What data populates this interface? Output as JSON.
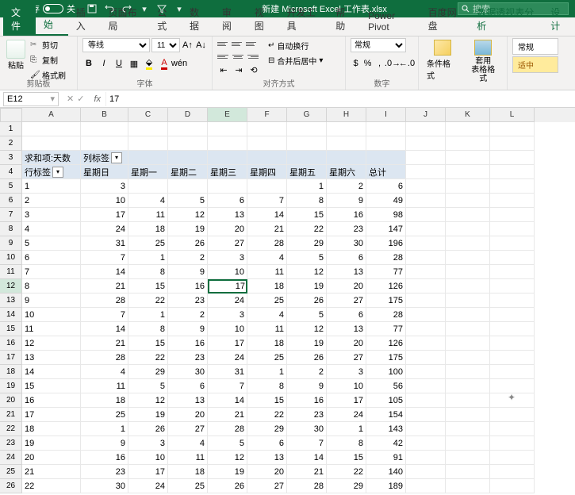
{
  "titlebar": {
    "autosave": "自动保存",
    "autosave_state": "关",
    "filename": "新建 Microsoft Excel 工作表.xlsx",
    "search_placeholder": "搜索"
  },
  "tabs": {
    "file": "文件",
    "home": "开始",
    "insert": "插入",
    "layout": "页面布局",
    "formulas": "公式",
    "data": "数据",
    "review": "审阅",
    "view": "视图",
    "dev": "开发工具",
    "help": "帮助",
    "powerpivot": "Power Pivot",
    "baidupan": "百度网盘",
    "pivot_analyze": "数据透视表分析",
    "design": "设计"
  },
  "ribbon": {
    "clipboard": {
      "group": "剪贴板",
      "paste": "粘贴",
      "cut": "剪切",
      "copy": "复制",
      "painter": "格式刷"
    },
    "font": {
      "group": "字体",
      "name": "等线",
      "size": "11",
      "bold": "B",
      "italic": "I",
      "underline": "U"
    },
    "align": {
      "group": "对齐方式",
      "wrap": "自动换行",
      "merge": "合并后居中"
    },
    "number": {
      "group": "数字",
      "format": "常规"
    },
    "styles": {
      "cond": "条件格式",
      "table": "套用\n表格格式",
      "normal": "常规",
      "mid": "适中"
    }
  },
  "formula_bar": {
    "cell_ref": "E12",
    "fx": "fx",
    "value": "17"
  },
  "grid": {
    "col_widths": {
      "A": 74,
      "B": 60,
      "C": 50,
      "D": 50,
      "E": 50,
      "F": 50,
      "G": 50,
      "H": 50,
      "I": 50,
      "J": 50,
      "K": 56,
      "L": 56
    },
    "col_letters": [
      "A",
      "B",
      "C",
      "D",
      "E",
      "F",
      "G",
      "H",
      "I",
      "J",
      "K",
      "L"
    ],
    "active_row": 12,
    "active_col": "E",
    "pivot": {
      "value_label": "求和项:天数",
      "col_label": "列标签",
      "row_label": "行标签",
      "headers": [
        "星期日",
        "星期一",
        "星期二",
        "星期三",
        "星期四",
        "星期五",
        "星期六",
        "总计"
      ]
    },
    "rows": [
      {
        "r": 1,
        "cells": [
          "",
          "",
          "",
          "",
          "",
          "",
          "",
          "",
          "",
          "",
          "",
          ""
        ]
      },
      {
        "r": 2,
        "cells": [
          "",
          "",
          "",
          "",
          "",
          "",
          "",
          "",
          "",
          "",
          "",
          ""
        ]
      },
      {
        "r": 3,
        "pivot_top": true
      },
      {
        "r": 4,
        "pivot_hdr": true
      },
      {
        "r": 5,
        "cells": [
          "1",
          "3",
          "",
          "",
          "",
          "",
          "1",
          "2",
          "6",
          "",
          "",
          ""
        ]
      },
      {
        "r": 6,
        "cells": [
          "2",
          "10",
          "4",
          "5",
          "6",
          "7",
          "8",
          "9",
          "49",
          "",
          "",
          ""
        ]
      },
      {
        "r": 7,
        "cells": [
          "3",
          "17",
          "11",
          "12",
          "13",
          "14",
          "15",
          "16",
          "98",
          "",
          "",
          ""
        ]
      },
      {
        "r": 8,
        "cells": [
          "4",
          "24",
          "18",
          "19",
          "20",
          "21",
          "22",
          "23",
          "147",
          "",
          "",
          ""
        ]
      },
      {
        "r": 9,
        "cells": [
          "5",
          "31",
          "25",
          "26",
          "27",
          "28",
          "29",
          "30",
          "196",
          "",
          "",
          ""
        ]
      },
      {
        "r": 10,
        "cells": [
          "6",
          "7",
          "1",
          "2",
          "3",
          "4",
          "5",
          "6",
          "28",
          "",
          "",
          ""
        ]
      },
      {
        "r": 11,
        "cells": [
          "7",
          "14",
          "8",
          "9",
          "10",
          "11",
          "12",
          "13",
          "77",
          "",
          "",
          ""
        ]
      },
      {
        "r": 12,
        "cells": [
          "8",
          "21",
          "15",
          "16",
          "17",
          "18",
          "19",
          "20",
          "126",
          "",
          "",
          ""
        ]
      },
      {
        "r": 13,
        "cells": [
          "9",
          "28",
          "22",
          "23",
          "24",
          "25",
          "26",
          "27",
          "175",
          "",
          "",
          ""
        ]
      },
      {
        "r": 14,
        "cells": [
          "10",
          "7",
          "1",
          "2",
          "3",
          "4",
          "5",
          "6",
          "28",
          "",
          "",
          ""
        ]
      },
      {
        "r": 15,
        "cells": [
          "11",
          "14",
          "8",
          "9",
          "10",
          "11",
          "12",
          "13",
          "77",
          "",
          "",
          ""
        ]
      },
      {
        "r": 16,
        "cells": [
          "12",
          "21",
          "15",
          "16",
          "17",
          "18",
          "19",
          "20",
          "126",
          "",
          "",
          ""
        ]
      },
      {
        "r": 17,
        "cells": [
          "13",
          "28",
          "22",
          "23",
          "24",
          "25",
          "26",
          "27",
          "175",
          "",
          "",
          ""
        ]
      },
      {
        "r": 18,
        "cells": [
          "14",
          "4",
          "29",
          "30",
          "31",
          "1",
          "2",
          "3",
          "100",
          "",
          "",
          ""
        ]
      },
      {
        "r": 19,
        "cells": [
          "15",
          "11",
          "5",
          "6",
          "7",
          "8",
          "9",
          "10",
          "56",
          "",
          "",
          ""
        ]
      },
      {
        "r": 20,
        "cells": [
          "16",
          "18",
          "12",
          "13",
          "14",
          "15",
          "16",
          "17",
          "105",
          "",
          "",
          ""
        ]
      },
      {
        "r": 21,
        "cells": [
          "17",
          "25",
          "19",
          "20",
          "21",
          "22",
          "23",
          "24",
          "154",
          "",
          "",
          ""
        ]
      },
      {
        "r": 22,
        "cells": [
          "18",
          "1",
          "26",
          "27",
          "28",
          "29",
          "30",
          "1",
          "143",
          "",
          "",
          ""
        ]
      },
      {
        "r": 23,
        "cells": [
          "19",
          "9",
          "3",
          "4",
          "5",
          "6",
          "7",
          "8",
          "42",
          "",
          "",
          ""
        ]
      },
      {
        "r": 24,
        "cells": [
          "20",
          "16",
          "10",
          "11",
          "12",
          "13",
          "14",
          "15",
          "91",
          "",
          "",
          ""
        ]
      },
      {
        "r": 25,
        "cells": [
          "21",
          "23",
          "17",
          "18",
          "19",
          "20",
          "21",
          "22",
          "140",
          "",
          "",
          ""
        ]
      },
      {
        "r": 26,
        "cells": [
          "22",
          "30",
          "24",
          "25",
          "26",
          "27",
          "28",
          "29",
          "189",
          "",
          "",
          ""
        ]
      }
    ]
  }
}
